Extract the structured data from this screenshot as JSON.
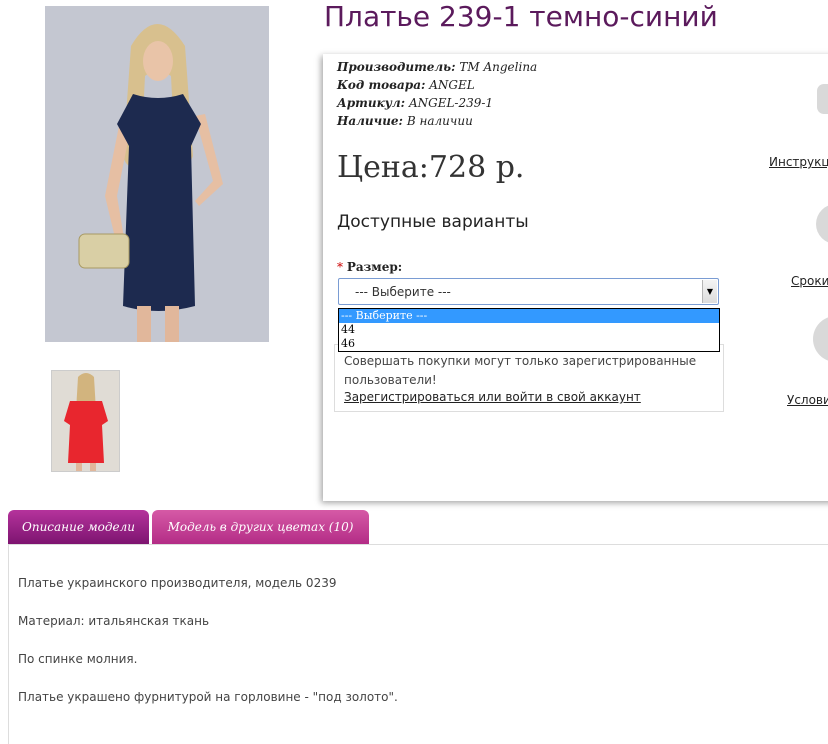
{
  "product": {
    "title": "Платье 239-1 темно-синий",
    "info": [
      {
        "label": "Производитель:",
        "value": "ТМ Angelina"
      },
      {
        "label": "Код товара:",
        "value": "ANGEL"
      },
      {
        "label": "Артикул:",
        "value": "ANGEL-239-1"
      },
      {
        "label": "Наличие:",
        "value": "В наличии"
      }
    ],
    "price": "Цена:728 р.",
    "variants_heading": "Доступные варианты"
  },
  "size": {
    "required_mark": "*",
    "label": "Размер:",
    "selected": "--- Выберите ---",
    "options": [
      "--- Выберите ---",
      "44",
      "46"
    ]
  },
  "notice": {
    "text": "Совершать покупки могут только зарегистрированные пользователи!",
    "link": "Зарегистрироваться или войти в свой аккаунт"
  },
  "side_links": [
    "Инструкци",
    "Сроки",
    "Услови"
  ],
  "tabs": [
    "Описание модели",
    "Модель в других цветах (10)"
  ],
  "description": [
    "Платье украинского производителя, модель 0239",
    "Материал: итальянская ткань",
    "По спинке молния.",
    "Платье украшено фурнитурой на горловине - \"под золото\"."
  ],
  "colors": {
    "title": "#5b1a5c",
    "tab_active": "#9c2384",
    "tab_inactive": "#c7449a",
    "dropdown_highlight": "#3399ff",
    "dress_main": "#1d2a4f",
    "dress_thumb": "#e8262e"
  }
}
